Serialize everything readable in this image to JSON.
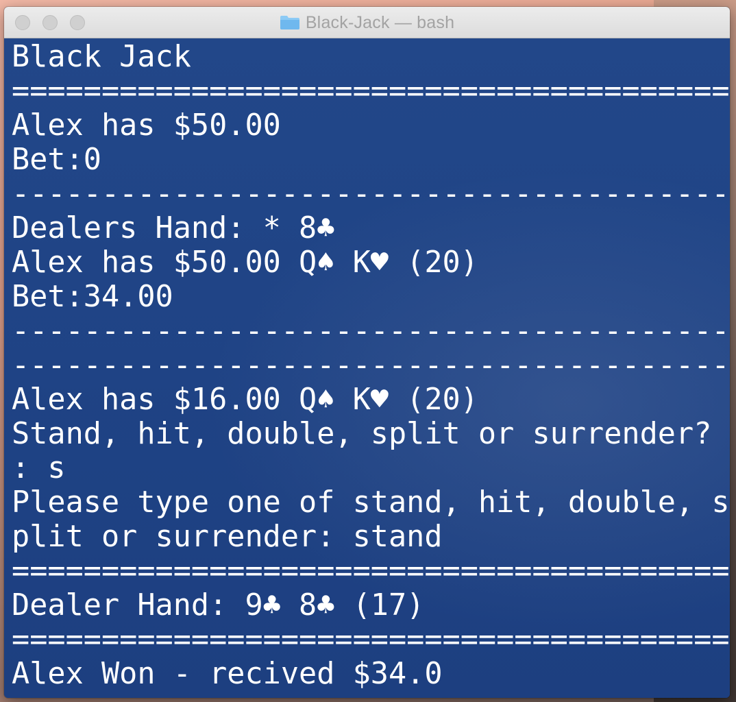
{
  "window": {
    "title": "Black-Jack — bash"
  },
  "terminal": {
    "lines": [
      "Black Jack",
      "========================================",
      "Alex has $50.00",
      "Bet:0",
      "----------------------------------------",
      "Dealers Hand: * 8♣",
      "Alex has $50.00 Q♠ K♥ (20)",
      "Bet:34.00",
      "----------------------------------------",
      "----------------------------------------",
      "Alex has $16.00 Q♠ K♥ (20)",
      "Stand, hit, double, split or surrender?",
      ": s",
      "Please type one of stand, hit, double, s",
      "plit or surrender: stand",
      "========================================",
      "Dealer Hand: 9♣ 8♣ (17)",
      "========================================",
      "Alex Won - recived $34.0"
    ]
  },
  "colors": {
    "terminal_bg": "#1f4283",
    "terminal_fg": "#ffffff",
    "titlebar_bg": "#e4e4e4",
    "folder_icon": "#6fb8ee"
  },
  "icons": {
    "window_title_icon": "folder-icon"
  }
}
